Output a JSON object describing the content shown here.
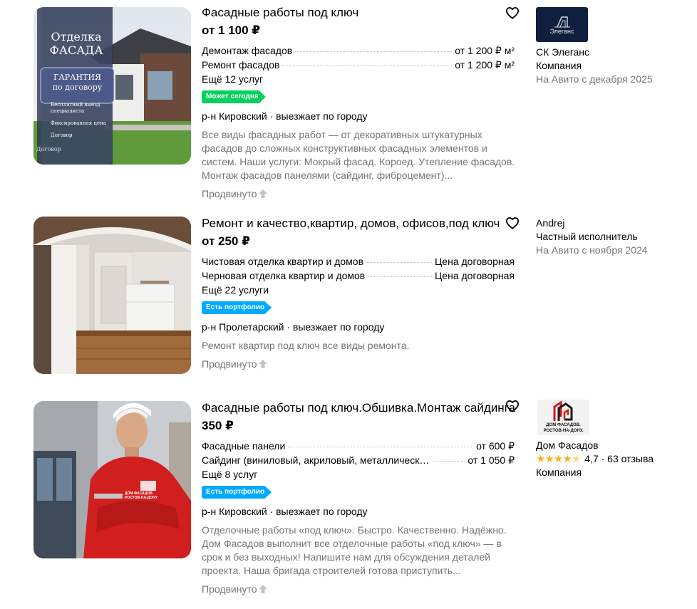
{
  "listings": [
    {
      "title": "Фасадные работы под ключ",
      "price": "от 1 100 ₽",
      "services": [
        {
          "name": "Демонтаж фасадов",
          "price": "от 1 200 ₽ м²"
        },
        {
          "name": "Ремонт фасадов",
          "price": "от 1 200 ₽ м²"
        }
      ],
      "more_services": "Ещё 12 услуг",
      "badge": "Может сегодня",
      "location": "р-н Кировский · выезжает по городу",
      "description": "Все виды фасадных работ — от декоративных штукатурных фасадов до сложных конструктивных фасадных элементов и систем. Наши услуги: Мокрый фасад. Короед. Утепление фасадов. Монтаж фасадов панелями (сайдинг, фиброцемент)...",
      "promoted": "Продвинуто",
      "photo_text": {
        "line1": "Отделка",
        "line2": "ФАСАДА",
        "guarantee1": "ГАРАНТИЯ",
        "guarantee2": "по договору",
        "feat1a": "Бесплатный выезд",
        "feat1b": "специалиста",
        "feat2": "Фиксированная цена",
        "feat3": "Договор",
        "bottom": "Договор"
      },
      "seller": {
        "logo_text": "Элеганс",
        "name": "СК Элеганс",
        "type": "Компания",
        "since": "На Авито с декабря 2025"
      }
    },
    {
      "title": "Ремонт и качество,квартир, домов, офисов,под ключ",
      "price": "от 250 ₽",
      "services": [
        {
          "name": "Чистовая отделка квартир и домов",
          "price": "Цена договорная"
        },
        {
          "name": "Черновая отделка квартир и домов",
          "price": "Цена договорная"
        }
      ],
      "more_services": "Ещё 22 услуги",
      "badge": "Есть портфолио",
      "location": "р-н Пролетарский · выезжает по городу",
      "description": "Ремонт квартир под ключ все виды ремонта.",
      "promoted": "Продвинуто",
      "seller": {
        "name": "Andrej",
        "type": "Частный исполнитель",
        "since": "На Авито с ноября 2024"
      }
    },
    {
      "title": "Фасадные работы под ключ.Обшивка.Монтаж сайдинга",
      "price": "350 ₽",
      "services": [
        {
          "name": "Фасадные панели",
          "price": "от 600 ₽"
        },
        {
          "name": "Сайдинг (виниловый, акриловый, металлический)",
          "price": "от 1 050 ₽"
        }
      ],
      "more_services": "Ещё 8 услуг",
      "badge": "Есть портфолио",
      "location": "р-н Кировский · выезжает по городу",
      "description": "Отделочные работы «под ключ». Быстро. Качественно. Надёжно. Дом Фасадов выполнит все отделочные работы «под ключ» — в срок и без выходных! Напишите нам для обсуждения деталей проекта. Наша бригада строителей готова приступить...",
      "promoted": "Продвинуто",
      "photo_text": {
        "jacket1": "ДОМ ФАСАДОВ",
        "jacket2": "РОСТОВ-НА-ДОНУ"
      },
      "seller": {
        "logo_text1": "ДОМ ФАСАДОВ.",
        "logo_text2": "РОСТОВ-НА-ДОНУ.",
        "name": "Дом Фасадов",
        "stars": 4.7,
        "rating": "4,7 · 63 отзыва",
        "type": "Компания"
      }
    }
  ],
  "colors": {
    "green_badge": "#02d15c",
    "blue_badge": "#00aaff",
    "muted_text": "#757575",
    "star": "#ffb021"
  },
  "icons": {
    "favorite": "heart-icon",
    "promoted": "arrow-up-icon",
    "star": "star-icon"
  }
}
